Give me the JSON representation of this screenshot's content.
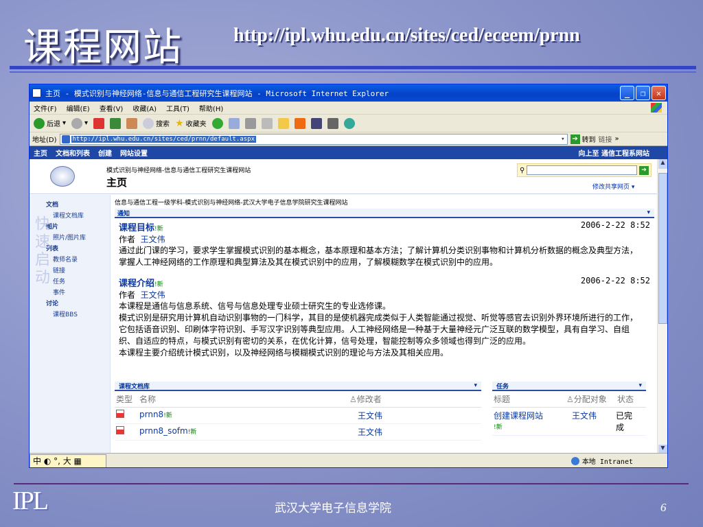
{
  "slide": {
    "title": "课程网站",
    "url": "http://ipl.whu.edu.cn/sites/ced/eceem/prnn",
    "footer": "武汉大学电子信息学院",
    "page_number": "6",
    "logo": "IPL",
    "watermark": "快速启动"
  },
  "browser": {
    "title": "主页 - 模式识别与神经网络-信息与通信工程研究生课程网站 - Microsoft Internet Explorer",
    "menu": [
      "文件(F)",
      "编辑(E)",
      "查看(V)",
      "收藏(A)",
      "工具(T)",
      "帮助(H)"
    ],
    "toolbar": {
      "back": "后退",
      "search": "搜索",
      "favorites": "收藏夹"
    },
    "address_label": "地址(D)",
    "address_value": "http://ipl.whu.edu.cn/sites/ced/prnn/default.aspx",
    "go_label": "转到",
    "links_label": "链接",
    "status_zone": "本地 Intranet",
    "ime": "中 ◐ °, 大 ▦"
  },
  "site": {
    "topnav": [
      "主页",
      "文档和列表",
      "创建",
      "网站设置"
    ],
    "topnav_right": "向上至 通信工程系网站",
    "header_small": "模式识别与神经网络-信息与通信工程研究生课程网站",
    "header_big": "主页",
    "modify_link": "修改共享网页 ▾",
    "breadcrumb": "信息与通信工程一级学科-模式识别与神经网络-武汉大学电子信息学院研究生课程网站",
    "leftnav": {
      "sec1": "文档",
      "sec1_items": [
        "课程文档库"
      ],
      "sec2": "图片",
      "sec2_items": [
        "照片/图片库"
      ],
      "sec3": "列表",
      "sec3_items": [
        "教师名录",
        "链接",
        "任务",
        "事件"
      ],
      "sec4": "讨论",
      "sec4_items": [
        "课程BBS"
      ]
    },
    "announcements": {
      "header": "通知",
      "items": [
        {
          "title": "课程目标",
          "new": "!新",
          "date": "2006-2-22 8:52",
          "author_label": "作者",
          "author": "王文伟",
          "body": [
            "通过此门课的学习，要求学生掌握模式识别的基本概念，基本原理和基本方法；了解计算机分类识别事物和计算机分析数据的概念及典型方法，掌握人工神经网络的工作原理和典型算法及其在模式识别中的应用，了解模糊数学在模式识别中的应用。"
          ]
        },
        {
          "title": "课程介绍",
          "new": "!新",
          "date": "2006-2-22 8:52",
          "author_label": "作者",
          "author": "王文伟",
          "body": [
            "本课程是通信与信息系统、信号与信息处理专业硕士研究生的专业选修课。",
            "模式识别是研究用计算机自动识别事物的一门科学，其目的是使机器完成类似于人类智能通过视觉、听觉等感官去识别外界环境所进行的工作，它包括语音识别、印刷体字符识别、手写汉字识别等典型应用。人工神经网络是一种基于大量神经元广泛互联的数学模型，具有自学习、自组织、自适应的特点，与模式识别有密切的关系，在优化计算，信号处理，智能控制等众多领域也得到广泛的应用。",
            "本课程主要介绍统计模式识别，以及神经网络与模糊模式识别的理论与方法及其相关应用。"
          ]
        }
      ]
    },
    "library": {
      "header": "课程文档库",
      "col_type": "类型",
      "col_name": "名称",
      "col_modified": "修改者",
      "rows": [
        {
          "name": "prnn8",
          "new": "!新",
          "modified": "王文伟"
        },
        {
          "name": "prnn8_sofm",
          "new": "!新",
          "modified": "王文伟"
        }
      ]
    },
    "tasks": {
      "header": "任务",
      "col_title": "标题",
      "col_assigned": "分配对象",
      "col_status": "状态",
      "rows": [
        {
          "title": "创建课程网站",
          "new": "!新",
          "assigned": "王文伟",
          "status": "已完成"
        }
      ]
    }
  }
}
